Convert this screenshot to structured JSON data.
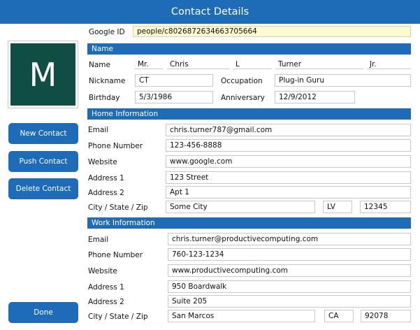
{
  "window": {
    "title": "Contact Details"
  },
  "avatar": {
    "initial": "M"
  },
  "actions": {
    "new_contact": "New Contact",
    "push_contact": "Push Contact",
    "delete_contact": "Delete Contact",
    "done": "Done"
  },
  "google_id": {
    "label": "Google ID",
    "value": "people/c8026872634663705664"
  },
  "name_section": {
    "header": "Name",
    "name_label": "Name",
    "prefix": "Mr.",
    "first": "Chris",
    "middle": "L",
    "last": "Turner",
    "suffix": "Jr.",
    "nickname_label": "Nickname",
    "nickname": "CT",
    "occupation_label": "Occupation",
    "occupation": "Plug-in Guru",
    "birthday_label": "Birthday",
    "birthday": "5/3/1986",
    "anniversary_label": "Anniversary",
    "anniversary": "12/9/2012"
  },
  "home": {
    "header": "Home Information",
    "email_label": "Email",
    "email": "chris.turner787@gmail.com",
    "phone_label": "Phone Number",
    "phone": "123-456-8888",
    "website_label": "Website",
    "website": "www.google.com",
    "address1_label": "Address 1",
    "address1": "123 Street",
    "address2_label": "Address 2",
    "address2": "Apt 1",
    "csz_label": "City / State / Zip",
    "city": "Some City",
    "state": "LV",
    "zip": "12345"
  },
  "work": {
    "header": "Work Information",
    "email_label": "Email",
    "email": "chris.turner@productivecomputing.com",
    "phone_label": "Phone Number",
    "phone": "760-123-1234",
    "website_label": "Website",
    "website": "www.productivecomputing.com",
    "address1_label": "Address 1",
    "address1": "950 Boardwalk",
    "address2_label": "Address 2",
    "address2": "Suite 205",
    "csz_label": "City / State / Zip",
    "city": "San Marcos",
    "state": "CA",
    "zip": "92078"
  },
  "colors": {
    "accent": "#1e6bb8",
    "avatar_bg": "#0f4d45",
    "highlight_field": "#fdf9d0"
  }
}
